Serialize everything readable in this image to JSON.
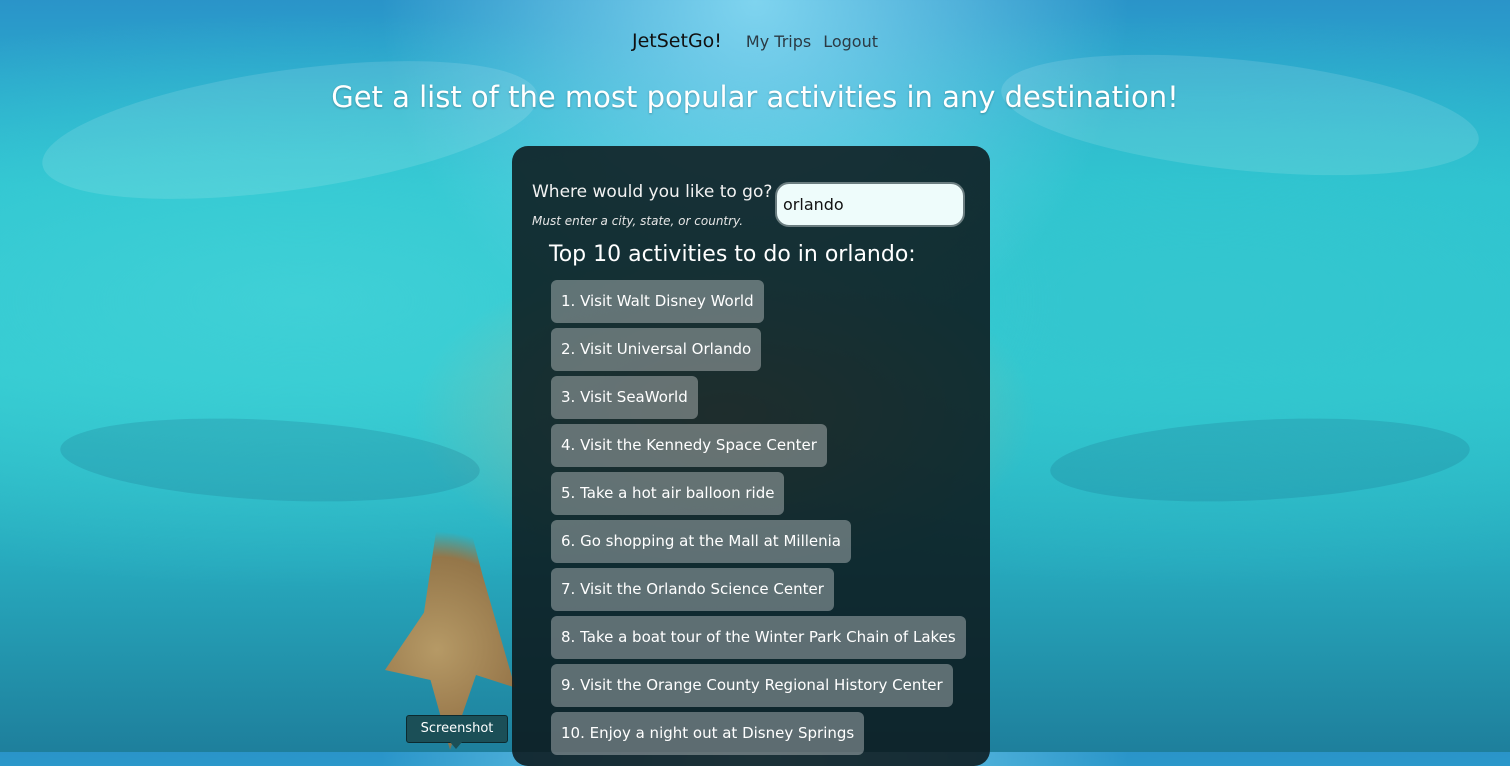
{
  "nav": {
    "brand": "JetSetGo!",
    "links": [
      "My Trips",
      "Logout"
    ]
  },
  "headline": "Get a list of the most popular activities in any destination!",
  "search": {
    "label": "Where would you like to go?",
    "hint": "Must enter a city, state, or country.",
    "value": "orlando"
  },
  "results": {
    "title": "Top 10 activities to do in orlando:",
    "items": [
      "1. Visit Walt Disney World",
      "2. Visit Universal Orlando",
      "3. Visit SeaWorld",
      "4. Visit the Kennedy Space Center",
      "5. Take a hot air balloon ride",
      "6. Go shopping at the Mall at Millenia",
      "7. Visit the Orlando Science Center",
      "8. Take a boat tour of the Winter Park Chain of Lakes",
      "9. Visit the Orange County Regional History Center",
      "10. Enjoy a night out at Disney Springs"
    ]
  },
  "tooltip": "Screenshot",
  "colors": {
    "panel": "#0c161a",
    "input_bg": "#eefcfb",
    "tooltip_bg": "#1b4f57"
  }
}
